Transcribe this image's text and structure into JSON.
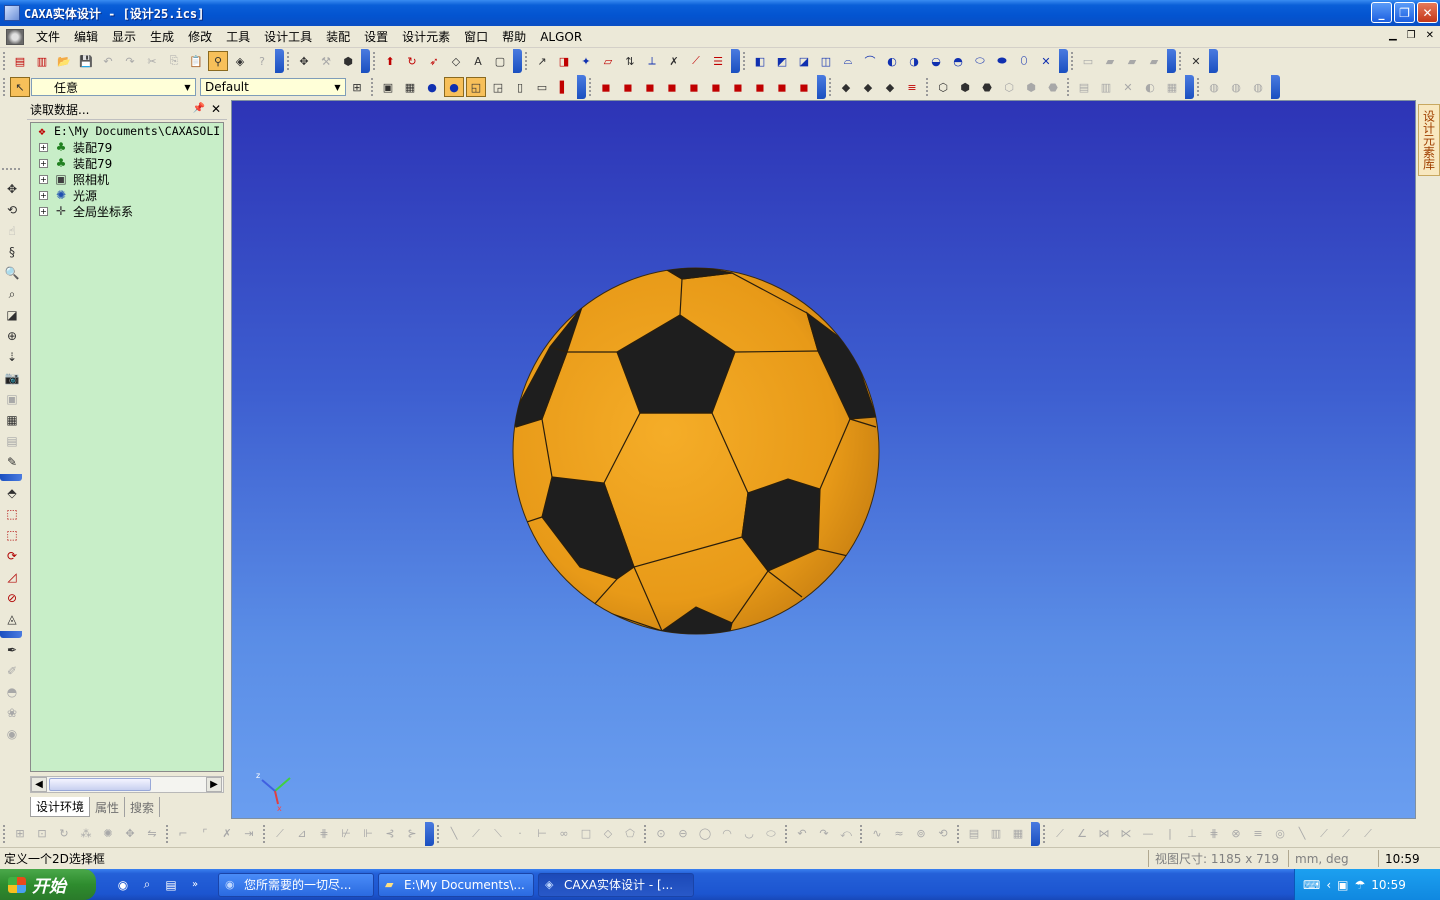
{
  "window": {
    "title": "CAXA实体设计 - [设计25.ics]"
  },
  "menu": [
    "文件",
    "编辑",
    "显示",
    "生成",
    "修改",
    "工具",
    "设计工具",
    "装配",
    "设置",
    "设计元素",
    "窗口",
    "帮助",
    "ALGOR"
  ],
  "toolbar2": {
    "select_filter": "任意",
    "config_combo": "Default"
  },
  "panel": {
    "title": "读取数据...",
    "root": "E:\\My Documents\\CAXASOLI",
    "items": [
      {
        "label": "装配79",
        "icon": "assembly-icon"
      },
      {
        "label": "装配79",
        "icon": "assembly-icon"
      },
      {
        "label": "照相机",
        "icon": "camera-icon"
      },
      {
        "label": "光源",
        "icon": "light-icon"
      },
      {
        "label": "全局坐标系",
        "icon": "coordinate-system-icon"
      }
    ],
    "tabs": [
      "设计环境",
      "属性",
      "搜索"
    ]
  },
  "right_dock": {
    "label": "设计元素库"
  },
  "status": {
    "message": "定义一个2D选择框",
    "view_size": "视图尺寸: 1185 x 719",
    "units": "mm, deg",
    "time": "10:59"
  },
  "taskbar": {
    "start": "开始",
    "tasks": [
      "您所需要的一切尽...",
      "E:\\My Documents\\...",
      "CAXA实体设计 - [..."
    ],
    "clock": "10:59"
  },
  "scene": {
    "object": "soccer-ball",
    "ball_yellow": "#f0a420",
    "ball_black": "#1e1e1e",
    "bg_top": "#2d34b6",
    "bg_bottom": "#6a9ef0"
  }
}
